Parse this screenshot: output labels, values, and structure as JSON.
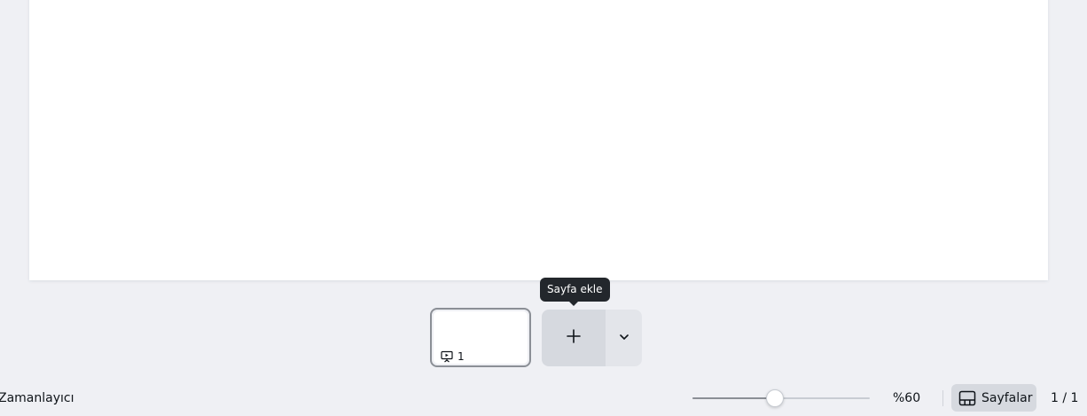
{
  "canvas": {
    "page_color": "#ffffff"
  },
  "pages_strip": {
    "thumbnail": {
      "page_number": "1",
      "icon": "presentation-icon"
    },
    "add_page": {
      "icon": "plus-icon",
      "tooltip": "Sayfa ekle"
    },
    "add_options": {
      "icon": "chevron-down-icon"
    }
  },
  "footer": {
    "timer_label": "Zamanlayıcı",
    "zoom": {
      "value_label": "%60",
      "slider_level": 0.46
    },
    "pages_button": {
      "label": "Sayfalar",
      "icon": "page-grid-icon"
    },
    "page_counter": "1 / 1"
  },
  "colors": {
    "background": "#eff0f4",
    "button_bg": "#d6d9df",
    "tooltip_bg": "#23272c"
  }
}
